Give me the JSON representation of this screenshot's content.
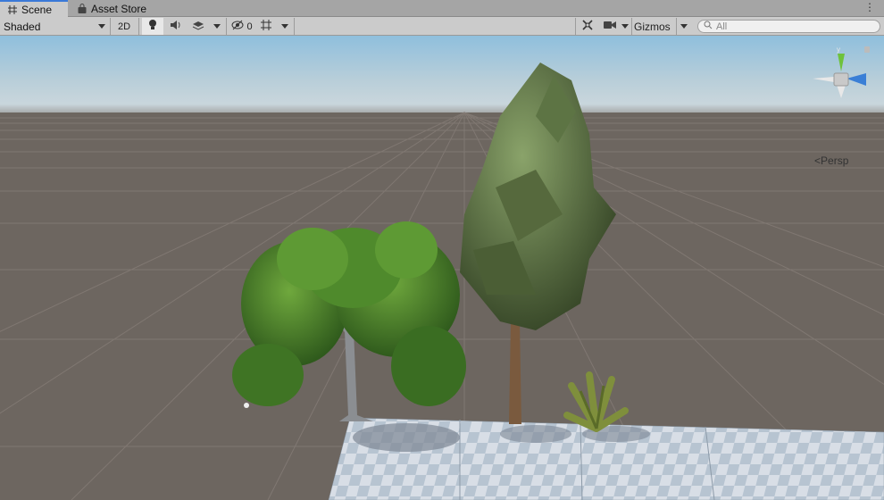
{
  "tabs": [
    {
      "label": "Scene",
      "icon": "grid-icon",
      "active": true
    },
    {
      "label": "Asset Store",
      "icon": "bag-icon",
      "active": false
    }
  ],
  "toolbar": {
    "draw_mode": "Shaded",
    "mode_2d": "2D",
    "hidden_count": "0",
    "gizmos": "Gizmos",
    "search_placeholder": "All"
  },
  "viewport": {
    "projection_label": "Persp",
    "colors": {
      "sky_top": "#8fbfdd",
      "horizon": "#c9d6dc",
      "ground": "#6d6660",
      "grid": "#807872",
      "checker_a": "#d8dee6",
      "checker_b": "#b7c4d1"
    }
  }
}
